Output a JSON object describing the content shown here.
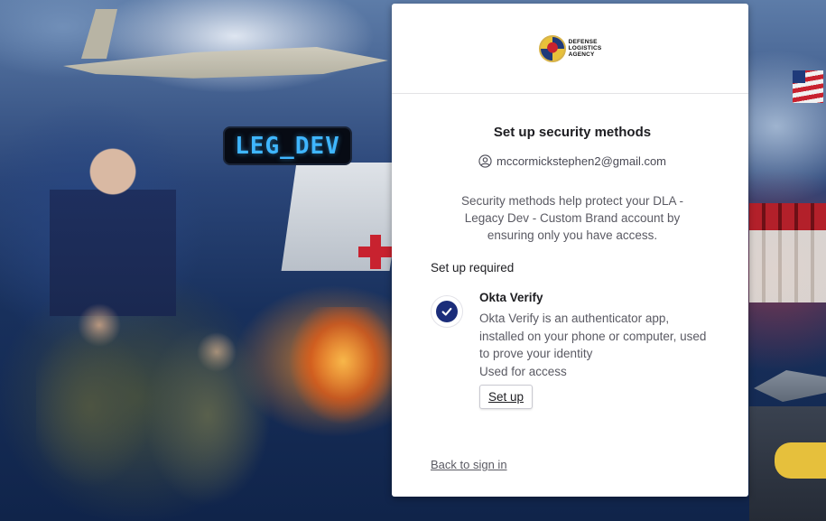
{
  "background": {
    "badge_text": "LEG_DEV"
  },
  "brand": {
    "line1": "DEFENSE",
    "line2": "LOGISTICS",
    "line3": "AGENCY"
  },
  "card": {
    "title": "Set up security methods",
    "email": "mccormickstephen2@gmail.com",
    "description": "Security methods help protect your DLA - Legacy Dev - Custom Brand account by ensuring only you have access.",
    "section_label": "Set up required",
    "authenticator": {
      "name": "Okta Verify",
      "description": "Okta Verify is an authenticator app, installed on your phone or computer, used to prove your identity",
      "usage": "Used for access",
      "button_label": "Set up"
    },
    "back_link": "Back to sign in"
  },
  "colors": {
    "badge_text": "#3fb6ff",
    "okta_blue": "#1b2d7a",
    "card_bg": "#ffffff"
  },
  "icons": [
    "user-icon",
    "okta-verify-icon",
    "dla-seal-icon"
  ]
}
